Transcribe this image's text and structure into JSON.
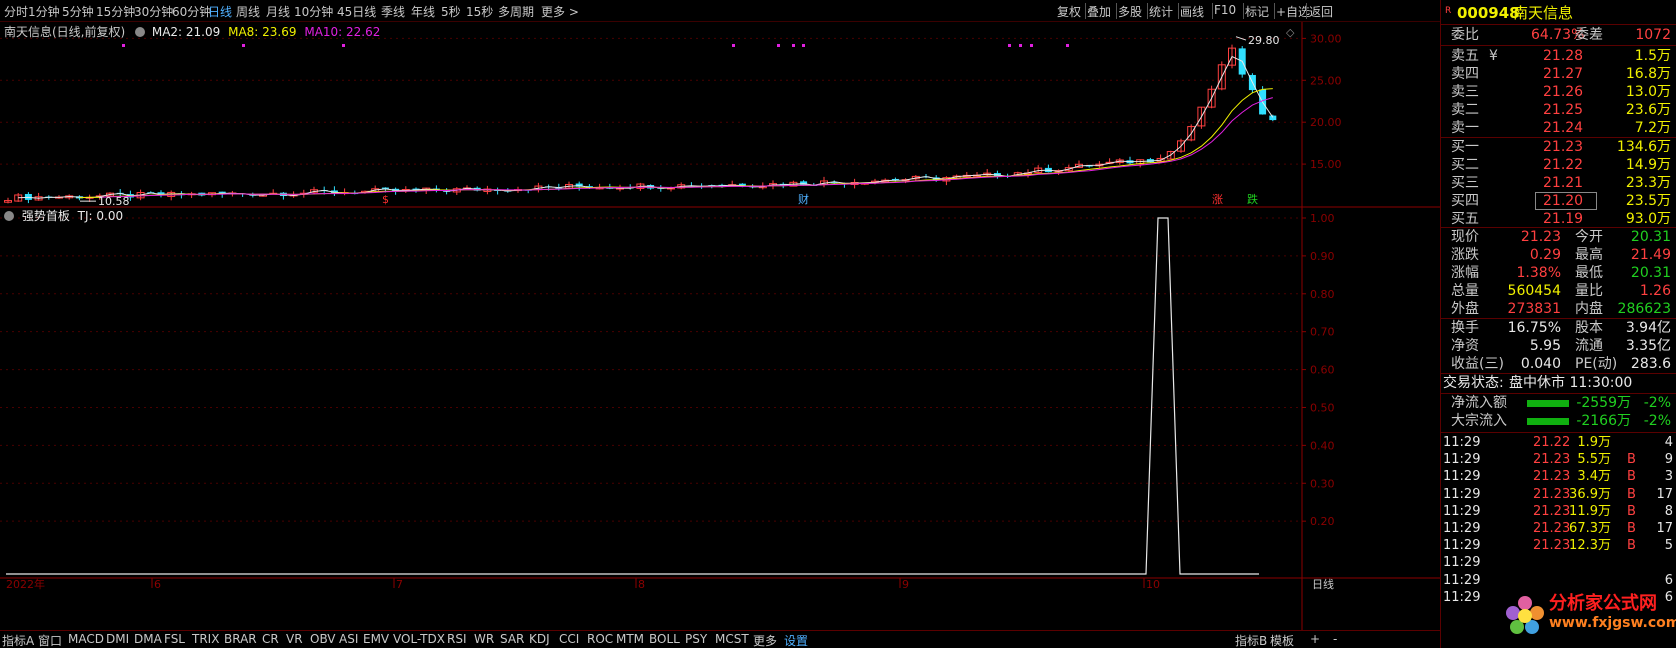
{
  "topbar": {
    "periods": [
      "分时",
      "1分钟",
      "5分钟",
      "15分钟",
      "30分钟",
      "60分钟",
      "日线",
      "周线",
      "月线",
      "10分钟",
      "45日线",
      "季线",
      "年线",
      "5秒",
      "15秒",
      "多周期",
      "更多 >"
    ],
    "active": "日线",
    "right_buttons": [
      "复权",
      "叠加",
      "多股",
      "统计",
      "画线",
      "F10",
      "标记",
      "+自选",
      "返回"
    ]
  },
  "main_chart": {
    "title": "南天信息(日线,前复权)",
    "ma_labels": [
      {
        "text": "MA2: 21.09",
        "color": "#e8e8e8"
      },
      {
        "text": "MA8: 23.69",
        "color": "#f0f000"
      },
      {
        "text": "MA10: 22.62",
        "color": "#e020e0"
      }
    ],
    "high_label": "29.80",
    "low_label": "10.58",
    "markers": [
      {
        "text": "$",
        "color": "#ff3030"
      },
      {
        "text": "财",
        "color": "#4fb0ff"
      },
      {
        "text": "涨",
        "color": "#ff3030"
      },
      {
        "text": "跌",
        "color": "#20d020"
      }
    ]
  },
  "sub_chart": {
    "title": "强势首板",
    "value_label": "TJ: 0.00"
  },
  "chart_data": {
    "type": "candlestick",
    "price_axis": {
      "ticks": [
        "30.00",
        "25.00",
        "20.00",
        "15.00"
      ],
      "ylim": [
        10,
        31
      ]
    },
    "indicator_axis": {
      "ticks": [
        "1.00",
        "0.90",
        "0.80",
        "0.70",
        "0.60",
        "0.50",
        "0.40",
        "0.30",
        "0.20"
      ],
      "ylim": [
        0.05,
        1.0
      ]
    },
    "x_labels": [
      "2022年",
      "6",
      "7",
      "8",
      "9",
      "10",
      "日线"
    ],
    "ma_series": [
      {
        "name": "MA2",
        "last": 21.09,
        "color": "#e8e8e8"
      },
      {
        "name": "MA8",
        "last": 23.69,
        "color": "#f0f000"
      },
      {
        "name": "MA10",
        "last": 22.62,
        "color": "#e020e0"
      }
    ],
    "indicator_series": {
      "name": "TJ",
      "last": 0.0,
      "spike_value": 1.0
    }
  },
  "bottombar": {
    "tabs": [
      "指标A",
      "窗口",
      "MACD",
      "DMI",
      "DMA",
      "FSL",
      "TRIX",
      "BRAR",
      "CR",
      "VR",
      "OBV",
      "ASI",
      "EMV",
      "VOL-TDX",
      "RSI",
      "WR",
      "SAR",
      "KDJ",
      "CCI",
      "ROC",
      "MTM",
      "BOLL",
      "PSY",
      "MCST",
      "更多",
      "设置"
    ],
    "active": "设置",
    "right": [
      "指标B",
      "模板",
      "+",
      "-"
    ]
  },
  "panel": {
    "code": "000948",
    "name": "南天信息",
    "weibi_label": "委比",
    "weibi": "64.73%",
    "weicha_label": "委差",
    "weicha": "1072",
    "asks": [
      {
        "label": "卖五",
        "price": "21.28",
        "vol": "1.5万"
      },
      {
        "label": "卖四",
        "price": "21.27",
        "vol": "16.8万"
      },
      {
        "label": "卖三",
        "price": "21.26",
        "vol": "13.0万"
      },
      {
        "label": "卖二",
        "price": "21.25",
        "vol": "23.6万"
      },
      {
        "label": "卖一",
        "price": "21.24",
        "vol": "7.2万"
      }
    ],
    "bids": [
      {
        "label": "买一",
        "price": "21.23",
        "vol": "134.6万"
      },
      {
        "label": "买二",
        "price": "21.22",
        "vol": "14.9万"
      },
      {
        "label": "买三",
        "price": "21.21",
        "vol": "23.3万"
      },
      {
        "label": "买四",
        "price": "21.20",
        "vol": "23.5万"
      },
      {
        "label": "买五",
        "price": "21.19",
        "vol": "93.0万"
      }
    ],
    "stats": [
      {
        "l1": "现价",
        "v1": "21.23",
        "c1": "c-red",
        "l2": "今开",
        "v2": "20.31",
        "c2": "c-green"
      },
      {
        "l1": "涨跌",
        "v1": "0.29",
        "c1": "c-red",
        "l2": "最高",
        "v2": "21.49",
        "c2": "c-red"
      },
      {
        "l1": "涨幅",
        "v1": "1.38%",
        "c1": "c-red",
        "l2": "最低",
        "v2": "20.31",
        "c2": "c-green"
      },
      {
        "l1": "总量",
        "v1": "560454",
        "c1": "c-yellow",
        "l2": "量比",
        "v2": "1.26",
        "c2": "c-red"
      },
      {
        "l1": "外盘",
        "v1": "273831",
        "c1": "c-red",
        "l2": "内盘",
        "v2": "286623",
        "c2": "c-green"
      }
    ],
    "stats2": [
      {
        "l1": "换手",
        "v1": "16.75%",
        "l2": "股本",
        "v2": "3.94亿"
      },
      {
        "l1": "净资",
        "v1": "5.95",
        "l2": "流通",
        "v2": "3.35亿"
      },
      {
        "l1": "收益(三)",
        "v1": "0.040",
        "l2": "PE(动)",
        "v2": "283.6"
      }
    ],
    "trade_status_label": "交易状态:",
    "trade_status": "盘中休市 11:30:00",
    "flows": [
      {
        "label": "净流入额",
        "value": "-2559万",
        "pct": "-2%"
      },
      {
        "label": "大宗流入",
        "value": "-2166万",
        "pct": "-2%"
      }
    ],
    "ticks": [
      {
        "time": "11:29",
        "price": "21.22",
        "vol": "1.9万",
        "bs": "",
        "n": "4"
      },
      {
        "time": "11:29",
        "price": "21.23",
        "vol": "5.5万",
        "bs": "B",
        "n": "9"
      },
      {
        "time": "11:29",
        "price": "21.23",
        "vol": "3.4万",
        "bs": "B",
        "n": "3"
      },
      {
        "time": "11:29",
        "price": "21.23",
        "vol": "36.9万",
        "bs": "B",
        "n": "17"
      },
      {
        "time": "11:29",
        "price": "21.23",
        "vol": "11.9万",
        "bs": "B",
        "n": "8"
      },
      {
        "time": "11:29",
        "price": "21.23",
        "vol": "67.3万",
        "bs": "B",
        "n": "17"
      },
      {
        "time": "11:29",
        "price": "21.23",
        "vol": "12.3万",
        "bs": "B",
        "n": "5"
      },
      {
        "time": "11:29",
        "price": "",
        "vol": "",
        "bs": "",
        "n": ""
      },
      {
        "time": "11:29",
        "price": "",
        "vol": "",
        "bs": "",
        "n": "6"
      },
      {
        "time": "11:29",
        "price": "",
        "vol": "",
        "bs": "",
        "n": "6"
      }
    ],
    "watermark_cn": "分析家公式网",
    "watermark_url": "www.fxjgsw.com"
  }
}
